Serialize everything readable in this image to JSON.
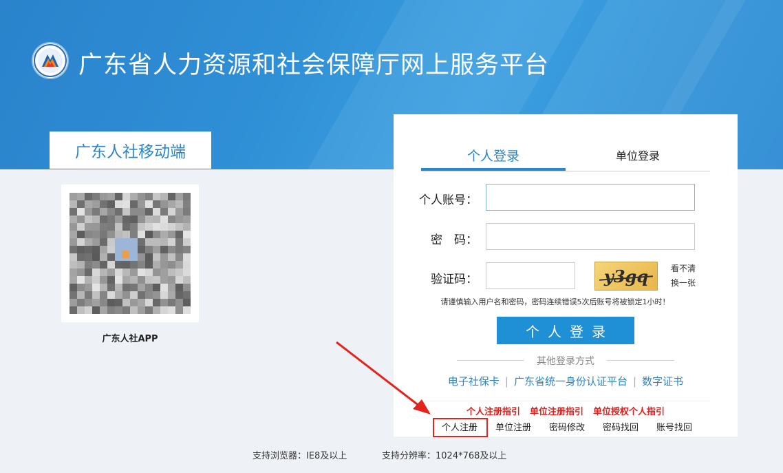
{
  "header": {
    "title": "广东省人力资源和社会保障厅网上服务平台",
    "logo_icon": "guangdong-hrss-logo-icon"
  },
  "mobile": {
    "tab_label": "广东人社移动端",
    "qr_caption": "广东人社APP"
  },
  "login": {
    "tabs": [
      {
        "label": "个人登录"
      },
      {
        "label": "单位登录"
      }
    ],
    "account_label": "个人账号：",
    "password_label": "密　码：",
    "captcha_label": "验证码：",
    "captcha_text": "y3gq",
    "captcha_refresh": "看不清换一张",
    "warning": "请谨慎输入用户名和密码，密码连续错误5次后账号将被锁定1小时！",
    "submit_label": "个人登录",
    "other_title": "其他登录方式",
    "methods": [
      {
        "label": "电子社保卡"
      },
      {
        "label": "广东省统一身份认证平台"
      },
      {
        "label": "数字证书"
      }
    ],
    "guides": [
      {
        "label": "个人注册指引"
      },
      {
        "label": "单位注册指引"
      },
      {
        "label": "单位授权个人指引"
      }
    ],
    "links": [
      {
        "label": "个人注册"
      },
      {
        "label": "单位注册"
      },
      {
        "label": "密码修改"
      },
      {
        "label": "密码找回"
      },
      {
        "label": "账号找回"
      }
    ]
  },
  "footer": {
    "browser": "支持浏览器：IE8及以上",
    "resolution": "支持分辨率：1024*768及以上"
  },
  "colors": {
    "accent": "#2a86c8",
    "button": "#1f8fd6",
    "guide_red": "#e0201c",
    "annotation_red": "#e3231c"
  }
}
